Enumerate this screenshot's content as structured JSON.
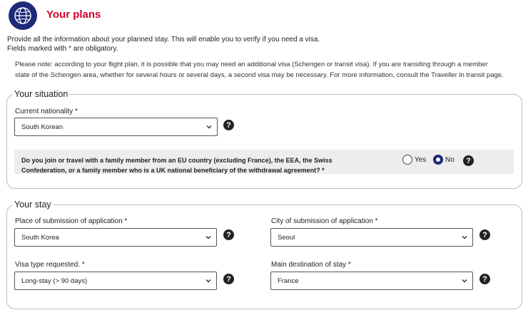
{
  "page": {
    "title": "Your plans",
    "intro_line1": "Provide all the information about your planned stay. This will enable you to verify if you need a visa.",
    "intro_line2": "Fields marked with * are obligatory.",
    "note_line1": "Please note: according to your flight plan, it is possible that you may need an additional visa (Schengen or transit visa). If you are transiting through a member",
    "note_line2": "state of the Schengen area, whether for several hours or several days, a second visa may be necessary. For more information, consult the Traveller in transit page."
  },
  "situation": {
    "legend": "Your situation",
    "nationality_label": "Current nationality *",
    "nationality_value": "South Korean",
    "family_question_line1": "Do you join or travel with a family member from an EU country (excluding France), the EEA, the Swiss",
    "family_question_line2": "Confederation, or a family member who is a UK national beneficiary of the withdrawal agreement? *",
    "yes_label": "Yes",
    "no_label": "No",
    "selected": "No"
  },
  "stay": {
    "legend": "Your stay",
    "place_label": "Place of submission of application *",
    "place_value": "South Korea",
    "city_label": "City of submission of application *",
    "city_value": "Seoul",
    "visa_type_label": "Visa type requested. *",
    "visa_type_value": "Long-stay (> 90 days)",
    "destination_label": "Main destination of stay *",
    "destination_value": "France"
  },
  "icons": {
    "help": "question-circle-icon",
    "dropdown": "chevron-down-icon",
    "logo": "globe-icon"
  },
  "colors": {
    "title": "#d4002a",
    "logo_bg": "#1d2a7a",
    "radio_selected": "#1d2a7a",
    "question_bar": "#ededed"
  }
}
